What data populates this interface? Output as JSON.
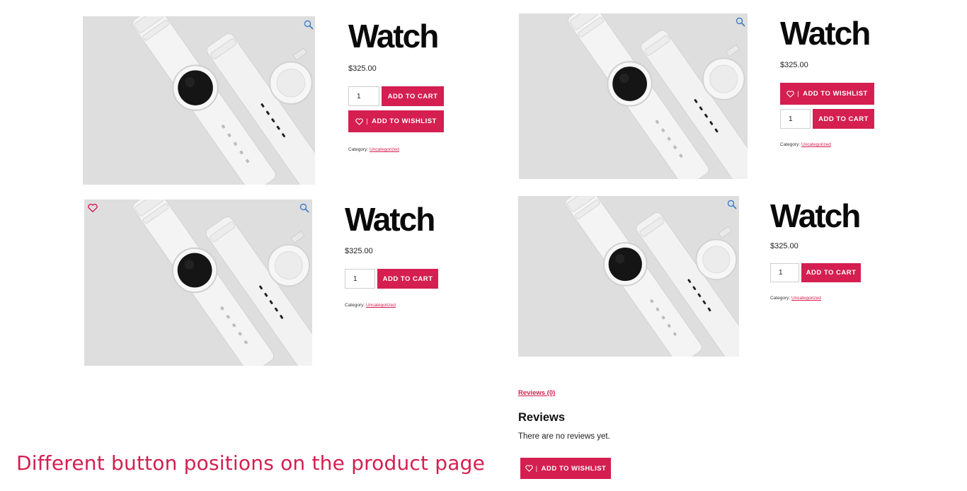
{
  "products": [
    {
      "title": "Watch",
      "price": "$325.00",
      "quantity": "1",
      "add_to_cart": "ADD TO CART",
      "wishlist_separator": "|",
      "add_to_wishlist": "ADD TO WISHLIST",
      "category_label": "Category:",
      "category_link": "Uncategorized"
    },
    {
      "title": "Watch",
      "price": "$325.00",
      "quantity": "1",
      "add_to_cart": "ADD TO CART",
      "wishlist_separator": "|",
      "add_to_wishlist": "ADD TO WISHLIST",
      "category_label": "Category:",
      "category_link": "Uncategorized"
    },
    {
      "title": "Watch",
      "price": "$325.00",
      "quantity": "1",
      "add_to_cart": "ADD TO CART",
      "category_label": "Category:",
      "category_link": "Uncategorized"
    },
    {
      "title": "Watch",
      "price": "$325.00",
      "quantity": "1",
      "add_to_cart": "ADD TO CART",
      "category_label": "Category:",
      "category_link": "Uncategorized"
    }
  ],
  "reviews": {
    "tab_label": "Reviews (0)",
    "heading": "Reviews",
    "empty_text": "There are no reviews yet.",
    "wishlist_separator": "|",
    "add_to_wishlist": "ADD TO WISHLIST"
  },
  "caption": "Different button positions on the product page",
  "colors": {
    "accent": "#d41f50",
    "image_bg": "#dededf",
    "zoom_icon": "#3b7fc4"
  },
  "icons": {
    "zoom": "magnifier-icon",
    "wishlist": "heart-icon"
  }
}
